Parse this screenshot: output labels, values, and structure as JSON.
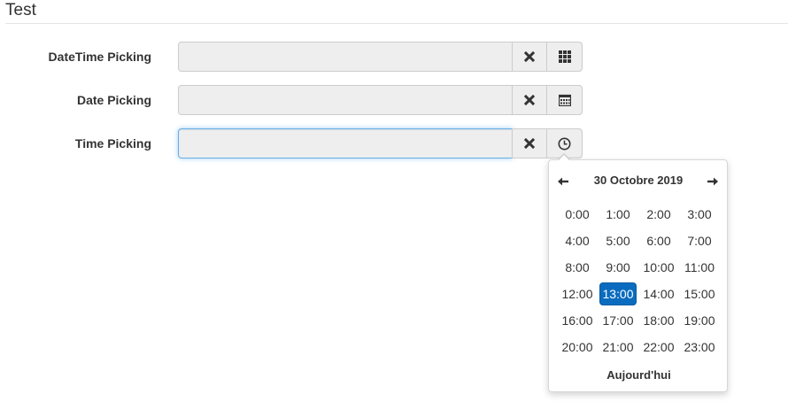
{
  "page": {
    "title": "Test"
  },
  "fields": [
    {
      "label": "DateTime Picking",
      "value": "",
      "picker_icon": "grid-icon"
    },
    {
      "label": "Date Picking",
      "value": "",
      "picker_icon": "calendar-icon"
    },
    {
      "label": "Time Picking",
      "value": "",
      "picker_icon": "clock-icon"
    }
  ],
  "time_picker": {
    "title": "30 Octobre 2019",
    "hours": [
      "0:00",
      "1:00",
      "2:00",
      "3:00",
      "4:00",
      "5:00",
      "6:00",
      "7:00",
      "8:00",
      "9:00",
      "10:00",
      "11:00",
      "12:00",
      "13:00",
      "14:00",
      "15:00",
      "16:00",
      "17:00",
      "18:00",
      "19:00",
      "20:00",
      "21:00",
      "22:00",
      "23:00"
    ],
    "selected_hour": "13:00",
    "today_label": "Aujourd'hui"
  },
  "colors": {
    "accent": "#0b6cbf",
    "focus_border": "#66afe9",
    "input_bg": "#eeeeee"
  }
}
